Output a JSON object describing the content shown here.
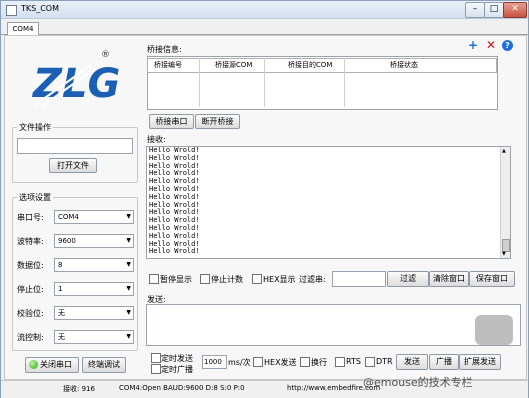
{
  "window": {
    "title": "TKS_COM",
    "minimize": "–",
    "maximize": "□",
    "close": "✕"
  },
  "tabs": [
    {
      "label": "COM4"
    }
  ],
  "toolbar_icons": {
    "add": "add-icon",
    "delete": "delete-icon",
    "help": "help-icon",
    "add_color": "#1e6fd9",
    "delete_color": "#d01818",
    "help_color": "#1e6fd9"
  },
  "logo": {
    "brand": "ZLG",
    "mark": "®",
    "color": "#1a5fb4"
  },
  "file_ops": {
    "title": "文件操作",
    "path_value": "",
    "open_button": "打开文件"
  },
  "options": {
    "title": "选项设置",
    "rows": [
      {
        "label": "串口号:",
        "value": "COM4"
      },
      {
        "label": "波特率:",
        "value": "9600"
      },
      {
        "label": "数据位:",
        "value": "8"
      },
      {
        "label": "停止位:",
        "value": "1"
      },
      {
        "label": "校验位:",
        "value": "无"
      },
      {
        "label": "流控制:",
        "value": "无"
      }
    ]
  },
  "port_controls": {
    "close_port": "关闭串口",
    "terminal_debug": "终端调试"
  },
  "bridge": {
    "title": "桥接信息:",
    "columns": [
      "桥接编号",
      "桥接源COM",
      "桥接目的COM",
      "桥接状态"
    ],
    "rows": [],
    "bridge_port_button": "桥接串口",
    "disconnect_button": "断开桥接"
  },
  "receive": {
    "label": "接收:",
    "lines": [
      "Hello Wrold!",
      "Hello Wrold!",
      "Hello Wrold!",
      "Hello Wrold!",
      "Hello Wrold!",
      "Hello Wrold!",
      "Hello Wrold!",
      "Hello Wrold!",
      "Hello Wrold!",
      "Hello Wrold!",
      "Hello Wrold!",
      "Hello Wrold!",
      "Hello Wrold!",
      "Hello Wrold!"
    ],
    "pause_display": "暂停显示",
    "stop_count": "停止计数",
    "hex_display": "HEX显示",
    "filter_label": "过滤串:",
    "filter_value": "",
    "filter_button": "过滤",
    "clear_window": "清除窗口",
    "save_window": "保存窗口"
  },
  "send": {
    "label": "发送:",
    "text": "",
    "timed_send": "定时发送",
    "timed_broadcast": "定时广播",
    "interval_value": "1000",
    "interval_unit": "ms/次",
    "hex_send": "HEX发送",
    "newline": "换行",
    "rts": "RTS",
    "dtr": "DTR",
    "send_button": "发送",
    "broadcast_button": "广播",
    "ext_send_button": "扩展发送"
  },
  "status": {
    "rx_count": "接收: 916",
    "port_info": "COM4:Open BAUD:9600 D:8 S:0 P:0",
    "url": "http://www.embedfire.com"
  },
  "watermark": "@emouse的技术专栏"
}
